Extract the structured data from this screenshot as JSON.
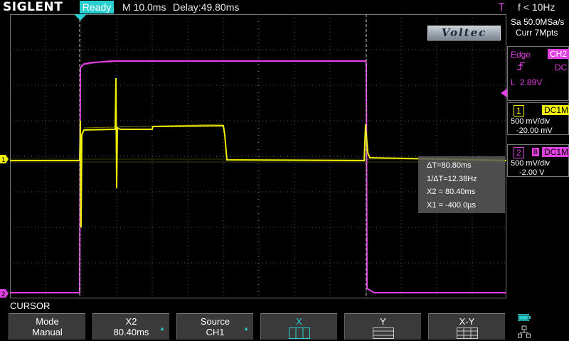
{
  "header": {
    "brand": "SIGLENT",
    "status": "Ready",
    "timebase": "M 10.0ms",
    "delay": "Delay:49.80ms",
    "freq": "f < 10Hz"
  },
  "acquisition": {
    "sample_rate": "Sa 50.0MSa/s",
    "memory": "Curr 7Mpts"
  },
  "watermark": "Voltec",
  "trigger": {
    "type": "Edge",
    "source": "CH2",
    "coupling": "DC",
    "level": "L  2.89V"
  },
  "channels": [
    {
      "num": "1",
      "coupling": "DC1M",
      "scale": "500 mV/div",
      "offset": "-20.00 mV",
      "color": "#f0f000"
    },
    {
      "num": "2",
      "coupling": "DC1M",
      "scale": "500 mV/div",
      "offset": "-2.00 V",
      "color": "#e040e0"
    }
  ],
  "cursor_info": {
    "delta_t": "ΔT=80.80ms",
    "inv_delta_t": "1/ΔT=12.38Hz",
    "x2": "X2 = 80.40ms",
    "x1": "X1 = -400.0µs"
  },
  "menu": {
    "title": "CURSOR",
    "softkeys": [
      {
        "top": "Mode",
        "bottom": "Manual"
      },
      {
        "top": "X2",
        "bottom": "80.40ms"
      },
      {
        "top": "Source",
        "bottom": "CH1"
      },
      {
        "top": "X",
        "bottom": ""
      },
      {
        "top": "Y",
        "bottom": ""
      },
      {
        "top": "X-Y",
        "bottom": ""
      }
    ]
  },
  "colors": {
    "ch1": "#f0f000",
    "ch2": "#e040e0",
    "accent": "#2ad0d0"
  }
}
